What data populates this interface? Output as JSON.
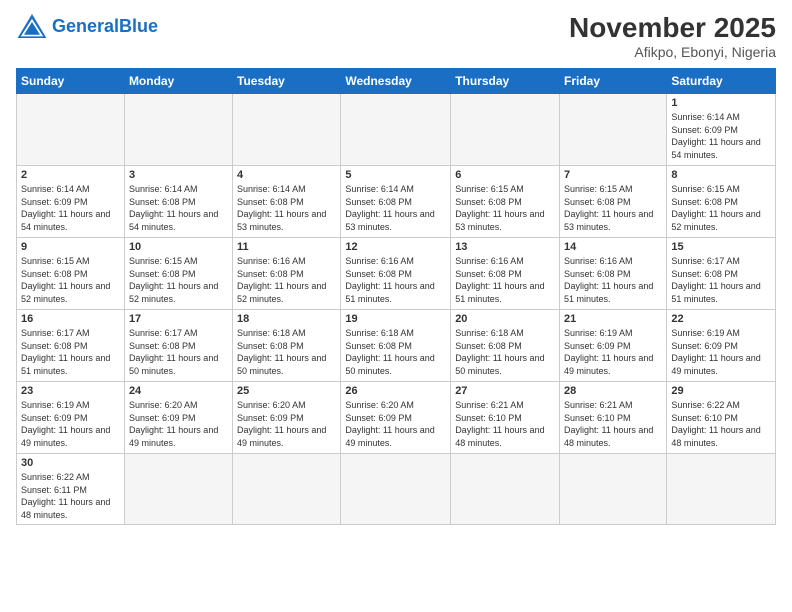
{
  "header": {
    "logo_general": "General",
    "logo_blue": "Blue",
    "month_title": "November 2025",
    "location": "Afikpo, Ebonyi, Nigeria"
  },
  "weekdays": [
    "Sunday",
    "Monday",
    "Tuesday",
    "Wednesday",
    "Thursday",
    "Friday",
    "Saturday"
  ],
  "days": {
    "1": {
      "sunrise": "6:14 AM",
      "sunset": "6:09 PM",
      "daylight": "11 hours and 54 minutes."
    },
    "2": {
      "sunrise": "6:14 AM",
      "sunset": "6:09 PM",
      "daylight": "11 hours and 54 minutes."
    },
    "3": {
      "sunrise": "6:14 AM",
      "sunset": "6:08 PM",
      "daylight": "11 hours and 54 minutes."
    },
    "4": {
      "sunrise": "6:14 AM",
      "sunset": "6:08 PM",
      "daylight": "11 hours and 53 minutes."
    },
    "5": {
      "sunrise": "6:14 AM",
      "sunset": "6:08 PM",
      "daylight": "11 hours and 53 minutes."
    },
    "6": {
      "sunrise": "6:15 AM",
      "sunset": "6:08 PM",
      "daylight": "11 hours and 53 minutes."
    },
    "7": {
      "sunrise": "6:15 AM",
      "sunset": "6:08 PM",
      "daylight": "11 hours and 53 minutes."
    },
    "8": {
      "sunrise": "6:15 AM",
      "sunset": "6:08 PM",
      "daylight": "11 hours and 52 minutes."
    },
    "9": {
      "sunrise": "6:15 AM",
      "sunset": "6:08 PM",
      "daylight": "11 hours and 52 minutes."
    },
    "10": {
      "sunrise": "6:15 AM",
      "sunset": "6:08 PM",
      "daylight": "11 hours and 52 minutes."
    },
    "11": {
      "sunrise": "6:16 AM",
      "sunset": "6:08 PM",
      "daylight": "11 hours and 52 minutes."
    },
    "12": {
      "sunrise": "6:16 AM",
      "sunset": "6:08 PM",
      "daylight": "11 hours and 51 minutes."
    },
    "13": {
      "sunrise": "6:16 AM",
      "sunset": "6:08 PM",
      "daylight": "11 hours and 51 minutes."
    },
    "14": {
      "sunrise": "6:16 AM",
      "sunset": "6:08 PM",
      "daylight": "11 hours and 51 minutes."
    },
    "15": {
      "sunrise": "6:17 AM",
      "sunset": "6:08 PM",
      "daylight": "11 hours and 51 minutes."
    },
    "16": {
      "sunrise": "6:17 AM",
      "sunset": "6:08 PM",
      "daylight": "11 hours and 51 minutes."
    },
    "17": {
      "sunrise": "6:17 AM",
      "sunset": "6:08 PM",
      "daylight": "11 hours and 50 minutes."
    },
    "18": {
      "sunrise": "6:18 AM",
      "sunset": "6:08 PM",
      "daylight": "11 hours and 50 minutes."
    },
    "19": {
      "sunrise": "6:18 AM",
      "sunset": "6:08 PM",
      "daylight": "11 hours and 50 minutes."
    },
    "20": {
      "sunrise": "6:18 AM",
      "sunset": "6:08 PM",
      "daylight": "11 hours and 50 minutes."
    },
    "21": {
      "sunrise": "6:19 AM",
      "sunset": "6:09 PM",
      "daylight": "11 hours and 49 minutes."
    },
    "22": {
      "sunrise": "6:19 AM",
      "sunset": "6:09 PM",
      "daylight": "11 hours and 49 minutes."
    },
    "23": {
      "sunrise": "6:19 AM",
      "sunset": "6:09 PM",
      "daylight": "11 hours and 49 minutes."
    },
    "24": {
      "sunrise": "6:20 AM",
      "sunset": "6:09 PM",
      "daylight": "11 hours and 49 minutes."
    },
    "25": {
      "sunrise": "6:20 AM",
      "sunset": "6:09 PM",
      "daylight": "11 hours and 49 minutes."
    },
    "26": {
      "sunrise": "6:20 AM",
      "sunset": "6:09 PM",
      "daylight": "11 hours and 49 minutes."
    },
    "27": {
      "sunrise": "6:21 AM",
      "sunset": "6:10 PM",
      "daylight": "11 hours and 48 minutes."
    },
    "28": {
      "sunrise": "6:21 AM",
      "sunset": "6:10 PM",
      "daylight": "11 hours and 48 minutes."
    },
    "29": {
      "sunrise": "6:22 AM",
      "sunset": "6:10 PM",
      "daylight": "11 hours and 48 minutes."
    },
    "30": {
      "sunrise": "6:22 AM",
      "sunset": "6:11 PM",
      "daylight": "11 hours and 48 minutes."
    }
  }
}
